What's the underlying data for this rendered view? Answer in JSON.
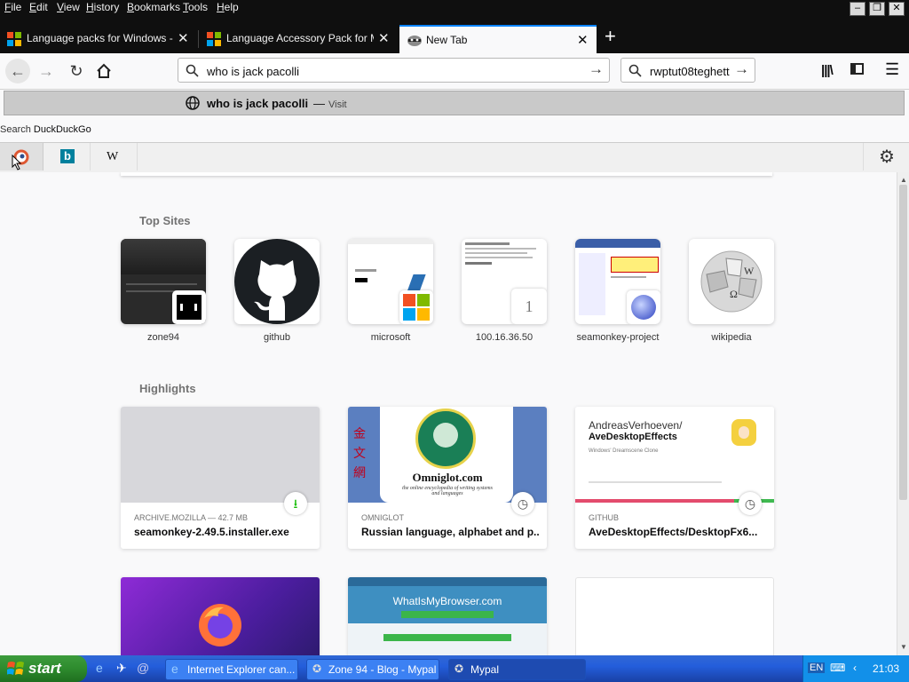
{
  "menubar": {
    "items": [
      {
        "label": "File",
        "key": "F",
        "rest": "ile"
      },
      {
        "label": "Edit",
        "key": "E",
        "rest": "dit"
      },
      {
        "label": "View",
        "key": "V",
        "rest": "iew"
      },
      {
        "label": "History",
        "key": "H",
        "rest": "istory"
      },
      {
        "label": "Bookmarks",
        "key": "B",
        "rest": "ookmarks"
      },
      {
        "label": "Tools",
        "key": "T",
        "rest": "ools"
      },
      {
        "label": "Help",
        "key": "H",
        "rest": "elp"
      }
    ]
  },
  "tabs": [
    {
      "title": "Language packs for Windows - Mic",
      "icon": "microsoft-logo-icon"
    },
    {
      "title": "Language Accessory Pack for Micr",
      "icon": "microsoft-logo-icon"
    },
    {
      "title": "New Tab",
      "icon": "mypal-raccoon-icon"
    }
  ],
  "navbar": {
    "url_value": "who is jack pacolli",
    "search_value": "rwptut08teghett"
  },
  "suggestion": {
    "text": "who is jack pacolli",
    "separator": "—",
    "action": "Visit"
  },
  "search_with": {
    "prefix": "Search ",
    "engine": "DuckDuckGo"
  },
  "oneoff_engines": [
    "duckduckgo-icon",
    "bing-icon",
    "wikipedia-icon"
  ],
  "top_sites": {
    "title": "Top Sites",
    "items": [
      {
        "label": "zone94"
      },
      {
        "label": "github"
      },
      {
        "label": "microsoft"
      },
      {
        "label": "100.16.36.50",
        "badge": "1"
      },
      {
        "label": "seamonkey-project"
      },
      {
        "label": "wikipedia"
      }
    ]
  },
  "highlights": {
    "title": "Highlights",
    "cards": [
      {
        "meta": "ARCHIVE.MOZILLA — 42.7 MB",
        "title": "seamonkey-2.49.5.installer.exe",
        "badge_icon": "download-icon"
      },
      {
        "meta": "OMNIGLOT",
        "title": "Russian language, alphabet and p...",
        "badge_icon": "clock-icon",
        "image_title": "Omniglot.com",
        "image_sub": "the online encyclopedia of writing systems and languages"
      },
      {
        "meta": "GITHUB",
        "title": "AveDesktopEffects/DesktopFx6...",
        "badge_icon": "clock-icon",
        "image_user": "AndreasVerhoeven/",
        "image_repo": "AveDesktopEffects",
        "image_desc": "Windows' Dreamscene Clone"
      }
    ],
    "row2": [
      {
        "image_title": "WhatIsMyBrowser.com"
      }
    ]
  },
  "taskbar": {
    "start": "start",
    "tasks": [
      {
        "title": "Internet Explorer can..."
      },
      {
        "title": "Zone 94 - Blog - Mypal"
      },
      {
        "title": "Mypal"
      }
    ],
    "lang": "EN",
    "clock": "21:03"
  },
  "colors": {
    "accent": "#0a84ff",
    "taskbar": "#245edb",
    "start": "#2e8b2e"
  }
}
